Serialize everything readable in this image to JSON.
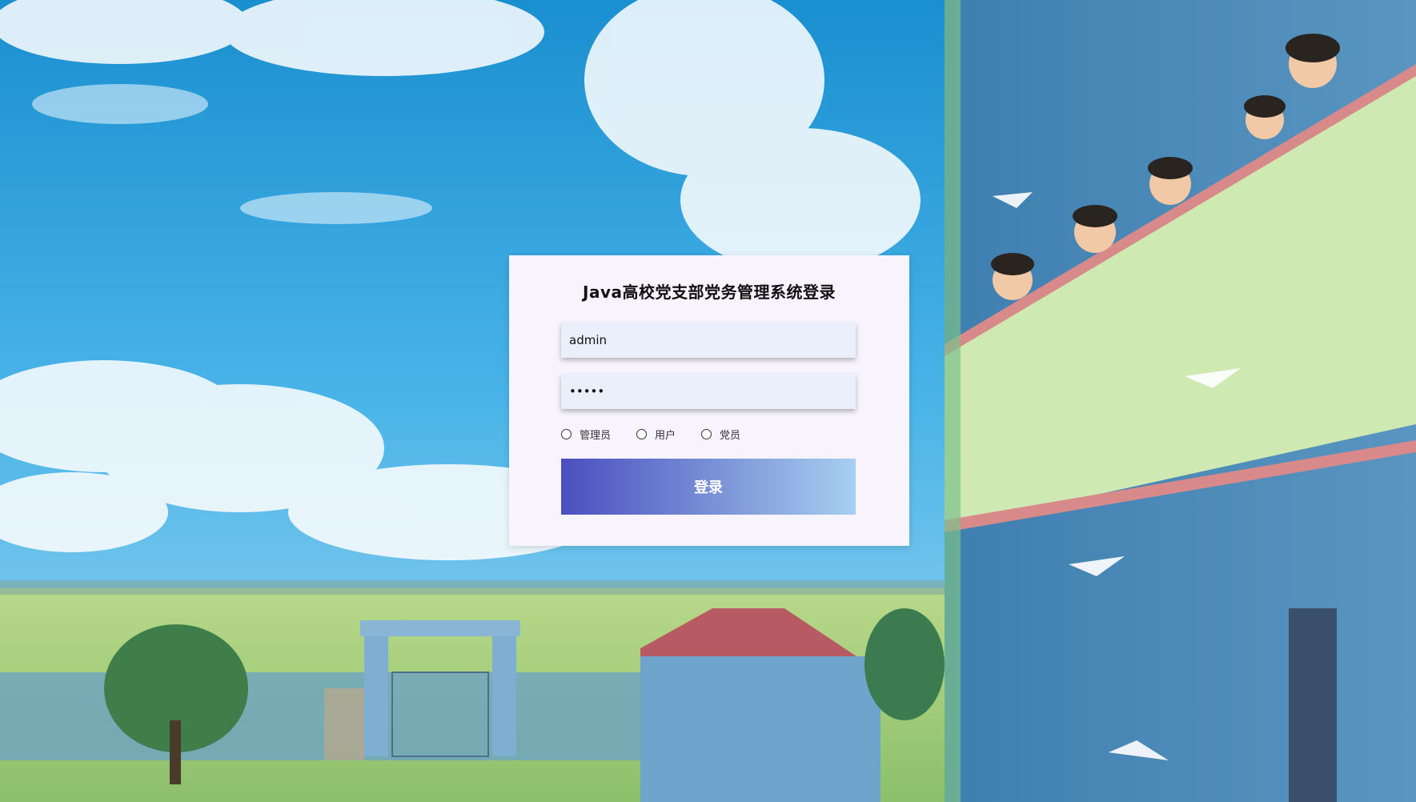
{
  "login": {
    "title": "Java高校党支部党务管理系统登录",
    "username_value": "admin",
    "password_value": "•••••",
    "roles": [
      {
        "label": "管理员"
      },
      {
        "label": "用户"
      },
      {
        "label": "党员"
      }
    ],
    "submit_label": "登录"
  },
  "colors": {
    "card_bg": "#f8f4fd",
    "input_bg": "#e9effb",
    "button_gradient_start": "#4b4fbf",
    "button_gradient_end": "#a7cff0"
  }
}
